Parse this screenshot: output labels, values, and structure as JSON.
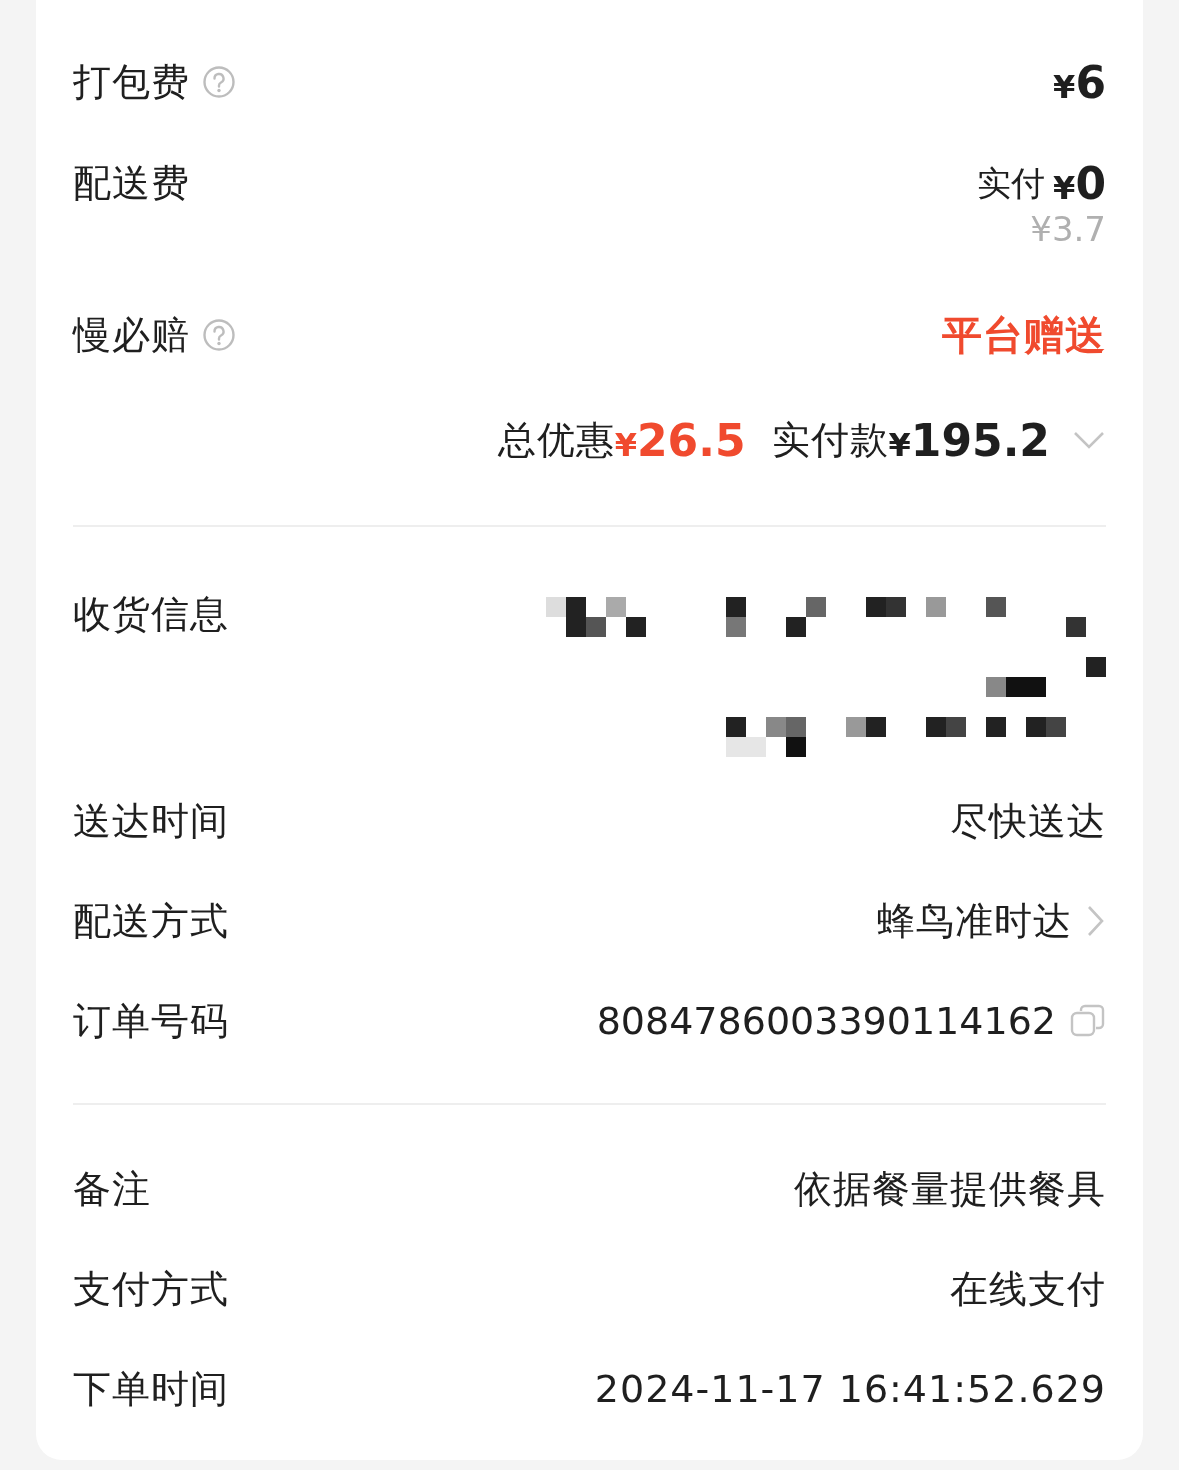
{
  "fees": [
    {
      "label": "打包费",
      "help": true,
      "kind": "price",
      "amount": "¥6"
    },
    {
      "label": "配送费",
      "help": false,
      "kind": "discounted",
      "paid_label": "实付",
      "amount": "¥0",
      "original": "¥3.7"
    },
    {
      "label": "慢必赔",
      "help": true,
      "kind": "gift",
      "value": "平台赠送"
    }
  ],
  "summary": {
    "discount_label": "总优惠",
    "discount": "¥26.5",
    "paid_label": "实付款",
    "paid": "¥195.2",
    "expanded": false
  },
  "delivery": [
    {
      "label": "收货信息",
      "kind": "redacted"
    },
    {
      "label": "送达时间",
      "kind": "text",
      "value": "尽快送达"
    },
    {
      "label": "配送方式",
      "kind": "link",
      "value": "蜂鸟准时达"
    },
    {
      "label": "订单号码",
      "kind": "copy",
      "value": "8084786003390114162"
    }
  ],
  "extra": [
    {
      "label": "备注",
      "value": "依据餐量提供餐具"
    },
    {
      "label": "支付方式",
      "value": "在线支付"
    },
    {
      "label": "下单时间",
      "value": "2024-11-17 16:41:52.629"
    }
  ]
}
